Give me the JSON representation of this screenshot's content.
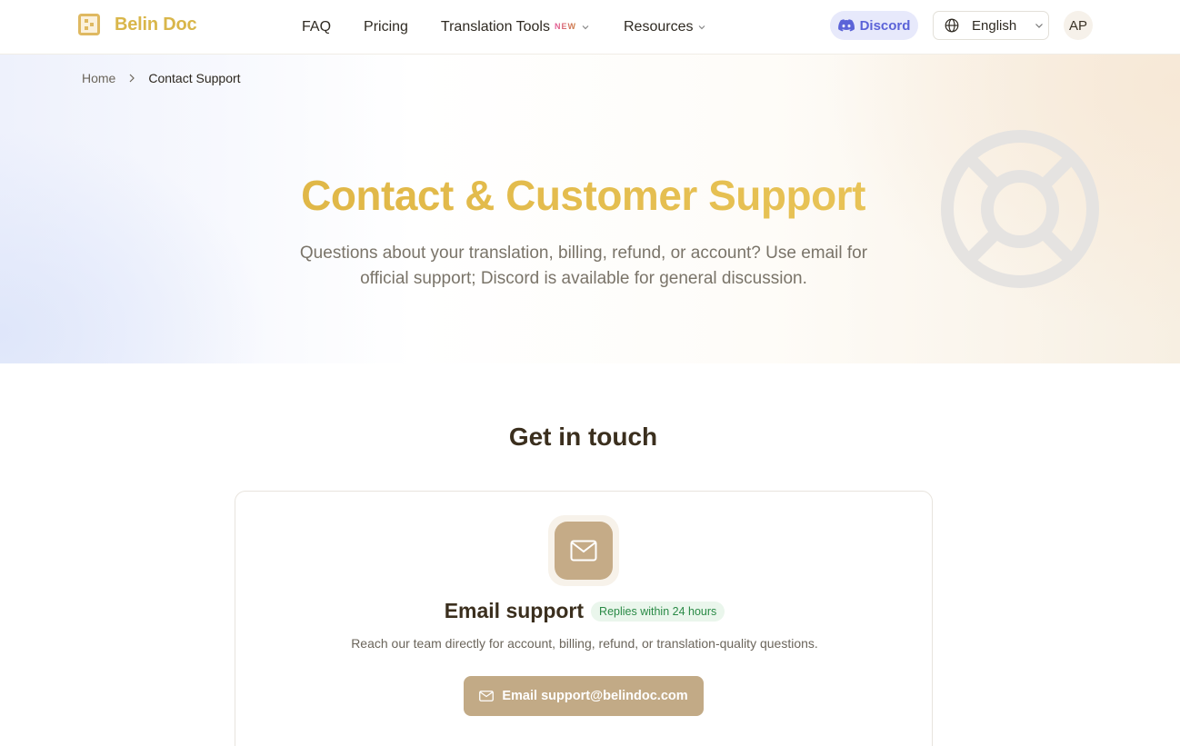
{
  "header": {
    "logo_text": "Belin Doc",
    "nav": {
      "faq": "FAQ",
      "pricing": "Pricing",
      "tools": "Translation Tools",
      "tools_badge": "NEW",
      "resources": "Resources"
    },
    "discord_label": "Discord",
    "language_label": "English",
    "avatar_initials": "AP"
  },
  "breadcrumb": {
    "home": "Home",
    "current": "Contact Support"
  },
  "hero": {
    "title": "Contact & Customer Support",
    "subtitle": "Questions about your translation, billing, refund, or account? Use email for official support; Discord is available for general discussion."
  },
  "section": {
    "title": "Get in touch"
  },
  "email_card": {
    "title": "Email support",
    "badge": "Replies within 24 hours",
    "description": "Reach our team directly for account, billing, refund, or translation-quality questions.",
    "button_label": "Email support@belindoc.com"
  },
  "icons": {
    "logo": "logo-mark-icon",
    "discord": "discord-icon",
    "language": "globe-icon",
    "dropdown": "chevron-down-icon",
    "breadcrumb_separator": "chevron-right-icon",
    "hero_decoration": "lifebuoy-icon",
    "email": "mail-icon"
  },
  "colors": {
    "brand_gold": "#d9b64a",
    "discord_accent": "#5b63d8",
    "email_button": "#c2aa86",
    "success_green": "#2a8a46"
  }
}
